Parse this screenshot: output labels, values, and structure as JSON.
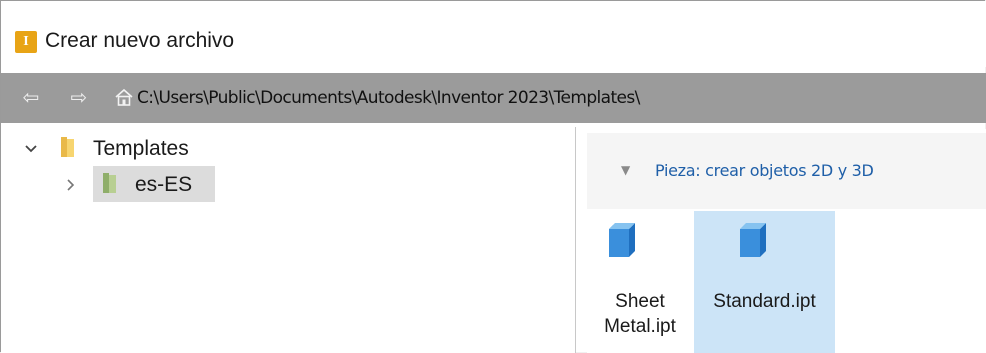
{
  "window": {
    "title": "Crear nuevo archivo",
    "app_icon_glyph": "I",
    "app_icon_color": "#e8a416"
  },
  "pathbar": {
    "back_icon": "back-arrow-icon",
    "forward_icon": "forward-arrow-icon",
    "home_icon": "home-icon",
    "path": "C:\\Users\\Public\\Documents\\Autodesk\\Inventor 2023\\Templates\\"
  },
  "tree": {
    "items": [
      {
        "label": "Templates",
        "expanded": true,
        "icon": "folder-icon"
      },
      {
        "label": "es-ES",
        "expanded": false,
        "selected": true,
        "icon": "folder-icon"
      }
    ]
  },
  "content": {
    "group_label": "Pieza: crear objetos 2D y 3D",
    "files": [
      {
        "label": "Sheet Metal.ipt",
        "icon": "cube-icon",
        "selected": false
      },
      {
        "label": "Standard.ipt",
        "icon": "cube-icon",
        "selected": true
      }
    ]
  },
  "colors": {
    "pathbar_bg": "#9b9b9b",
    "selection_blue": "#cce4f7",
    "tree_selection": "#dcdcdc",
    "group_label": "#1f5fa8"
  }
}
